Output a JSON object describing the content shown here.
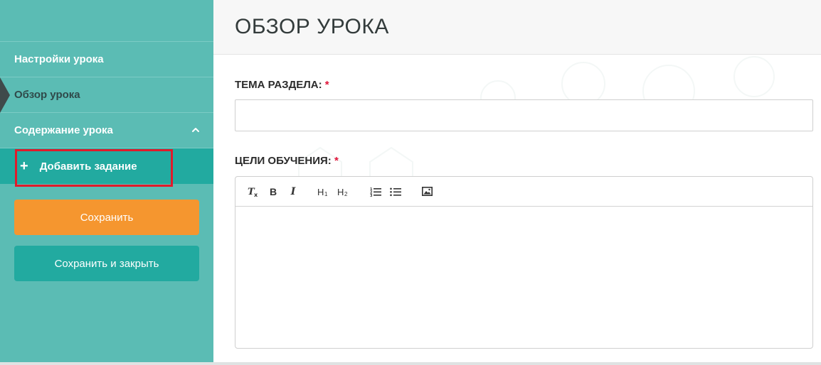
{
  "sidebar": {
    "items": [
      {
        "label": "Настройки урока"
      },
      {
        "label": "Обзор урока"
      },
      {
        "label": "Содержание урока"
      }
    ],
    "sub_item": {
      "icon": "+",
      "label": "Добавить задание"
    },
    "save_label": "Сохранить",
    "save_close_label": "Сохранить и закрыть"
  },
  "main": {
    "title": "ОБЗОР УРОКА",
    "topic_label": "ТЕМА РАЗДЕЛА:",
    "goals_label": "ЦЕЛИ ОБУЧЕНИЯ:",
    "required_mark": "*",
    "topic_value": "",
    "toolbar": {
      "clear_format": "Tx",
      "bold": "B",
      "italic": "I",
      "h1": "H1",
      "h2": "H2"
    }
  },
  "colors": {
    "sidebar_bg": "#5bbcb4",
    "accent_teal": "#22aaa0",
    "save_orange": "#f5962f",
    "required_red": "#e0163a",
    "highlight_red": "#e01b2b"
  }
}
